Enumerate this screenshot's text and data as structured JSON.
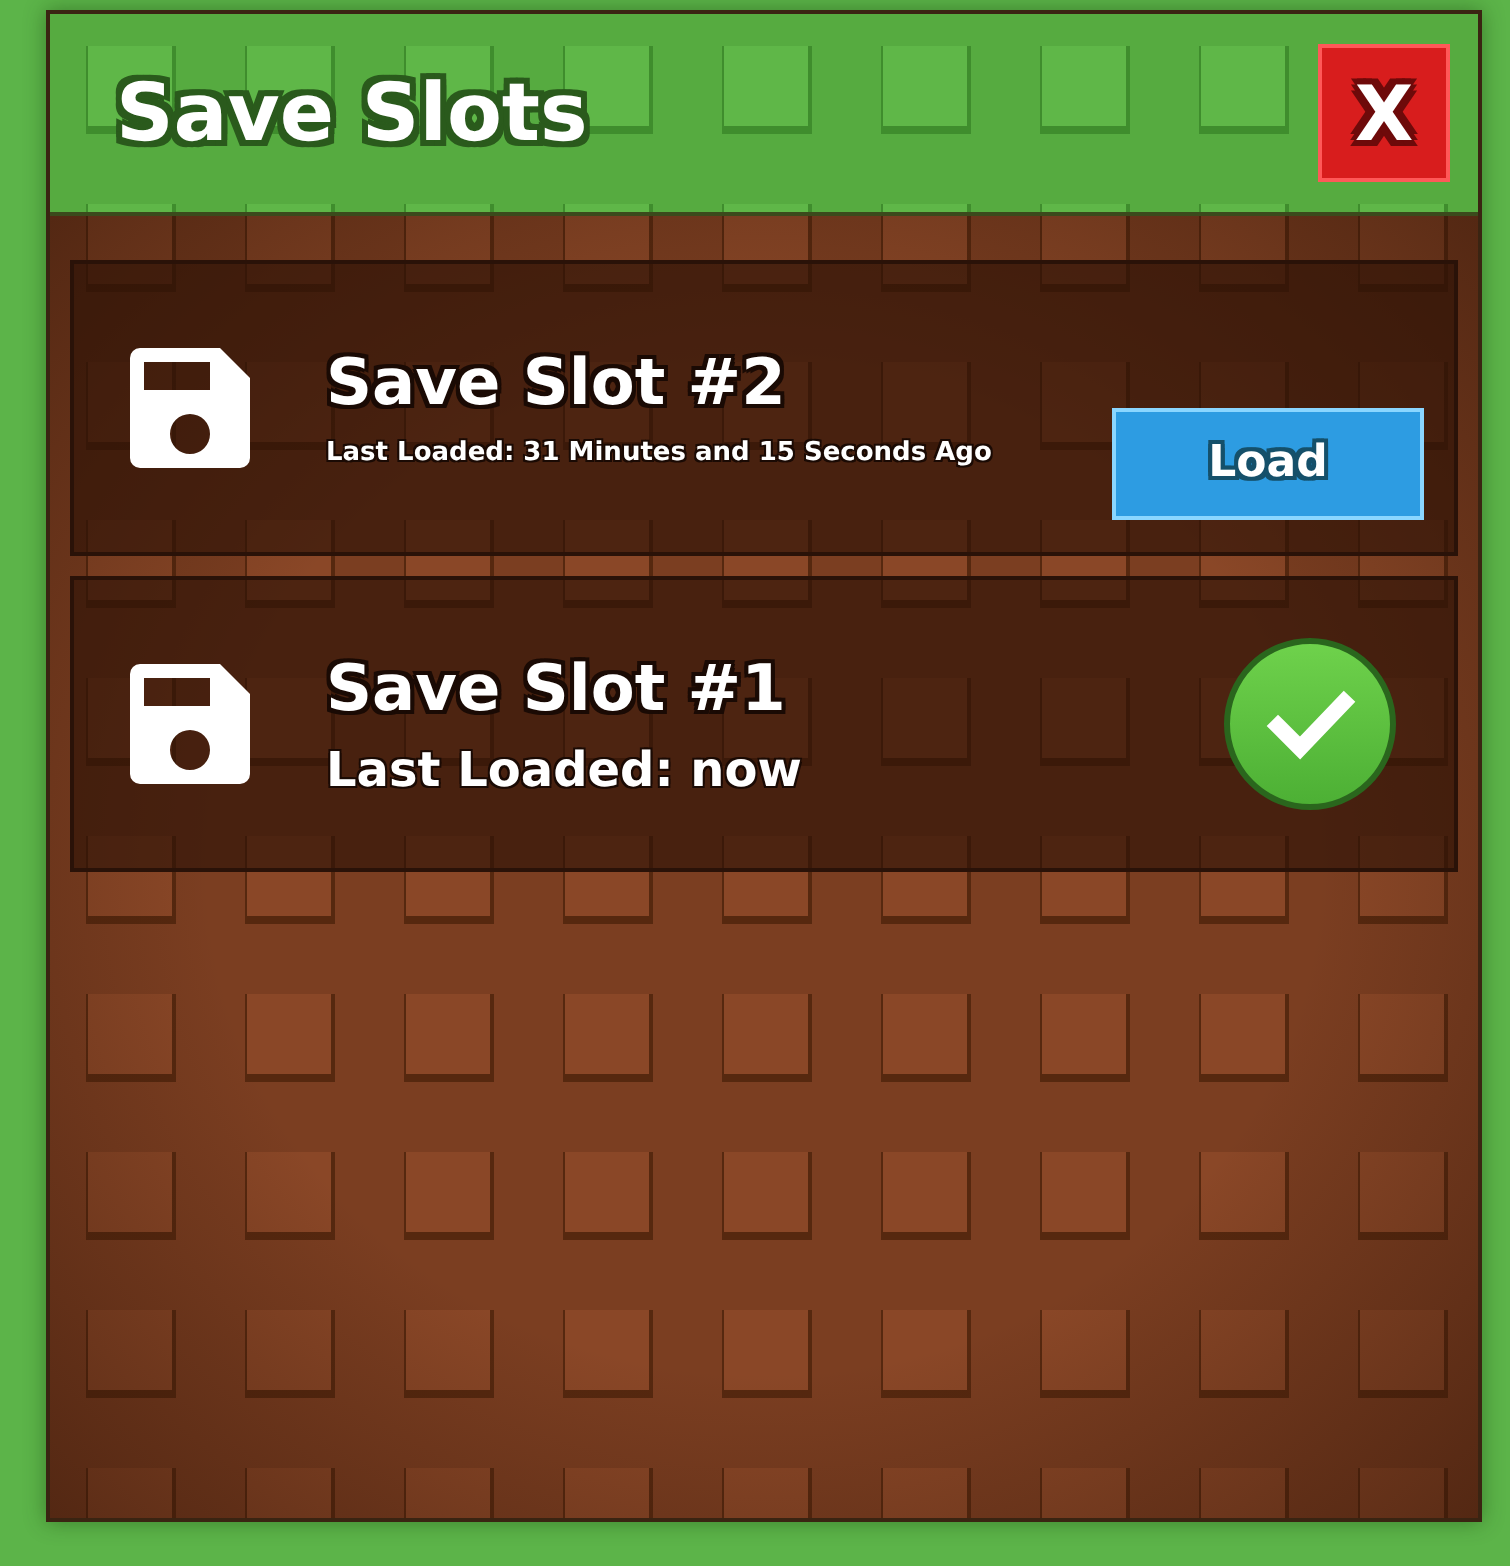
{
  "window": {
    "title": "Save Slots",
    "close_label": "X"
  },
  "slots": [
    {
      "title": "Save Slot #2",
      "last_loaded": "Last Loaded: 31 Minutes and 15 Seconds Ago",
      "selected": false,
      "action": "Load"
    },
    {
      "title": "Save Slot #1",
      "last_loaded": "Last Loaded: now",
      "selected": true
    }
  ]
}
